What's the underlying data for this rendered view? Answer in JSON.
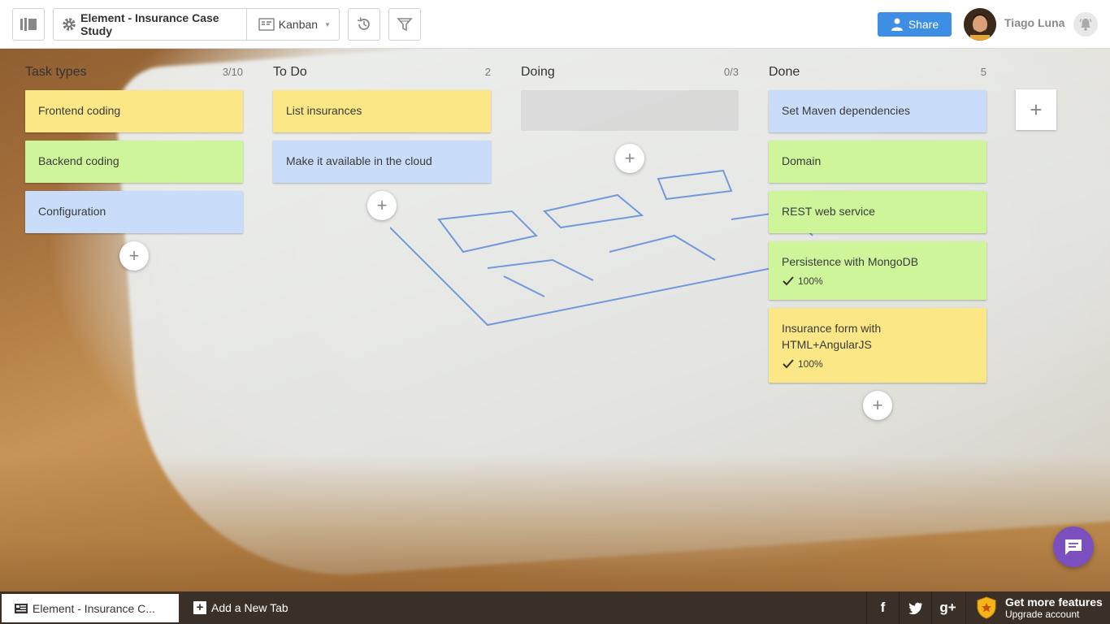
{
  "header": {
    "board_title": "Element - Insurance Case Study",
    "view_label": "Kanban",
    "share_label": "Share",
    "user_name": "Tiago Luna"
  },
  "columns": [
    {
      "title": "Task types",
      "count": "3/10",
      "cards": [
        {
          "text": "Frontend coding",
          "color": "yellow"
        },
        {
          "text": "Backend coding",
          "color": "green"
        },
        {
          "text": "Configuration",
          "color": "blue"
        }
      ]
    },
    {
      "title": "To Do",
      "count": "2",
      "cards": [
        {
          "text": "List insurances",
          "color": "yellow"
        },
        {
          "text": "Make it available in the cloud",
          "color": "blue"
        }
      ]
    },
    {
      "title": "Doing",
      "count": "0/3",
      "cards": []
    },
    {
      "title": "Done",
      "count": "5",
      "cards": [
        {
          "text": "Set Maven dependencies",
          "color": "blue"
        },
        {
          "text": "Domain",
          "color": "green"
        },
        {
          "text": "REST web service",
          "color": "green"
        },
        {
          "text": "Persistence with MongoDB",
          "color": "green",
          "progress": "100%"
        },
        {
          "text": "Insurance form with HTML+AngularJS",
          "color": "yellow",
          "progress": "100%"
        }
      ]
    }
  ],
  "colors": {
    "yellow": "#fbe785",
    "green": "#cff59b",
    "blue": "#c9dcfa",
    "share": "#3f8ee6",
    "chat": "#7b4fbe"
  },
  "footer": {
    "active_tab": "Element - Insurance C...",
    "add_tab": "Add a New Tab",
    "social": [
      "f",
      "twitter-icon",
      "g+"
    ],
    "upgrade_main": "Get more features",
    "upgrade_sub": "Upgrade account"
  },
  "icons": [
    "sidebar-toggle-icon",
    "gear-icon",
    "kanban-icon",
    "history-icon",
    "filter-icon",
    "share-user-icon",
    "bell-icon",
    "plus-icon",
    "check-icon",
    "chat-icon",
    "board-tab-icon",
    "star-shield-icon"
  ]
}
